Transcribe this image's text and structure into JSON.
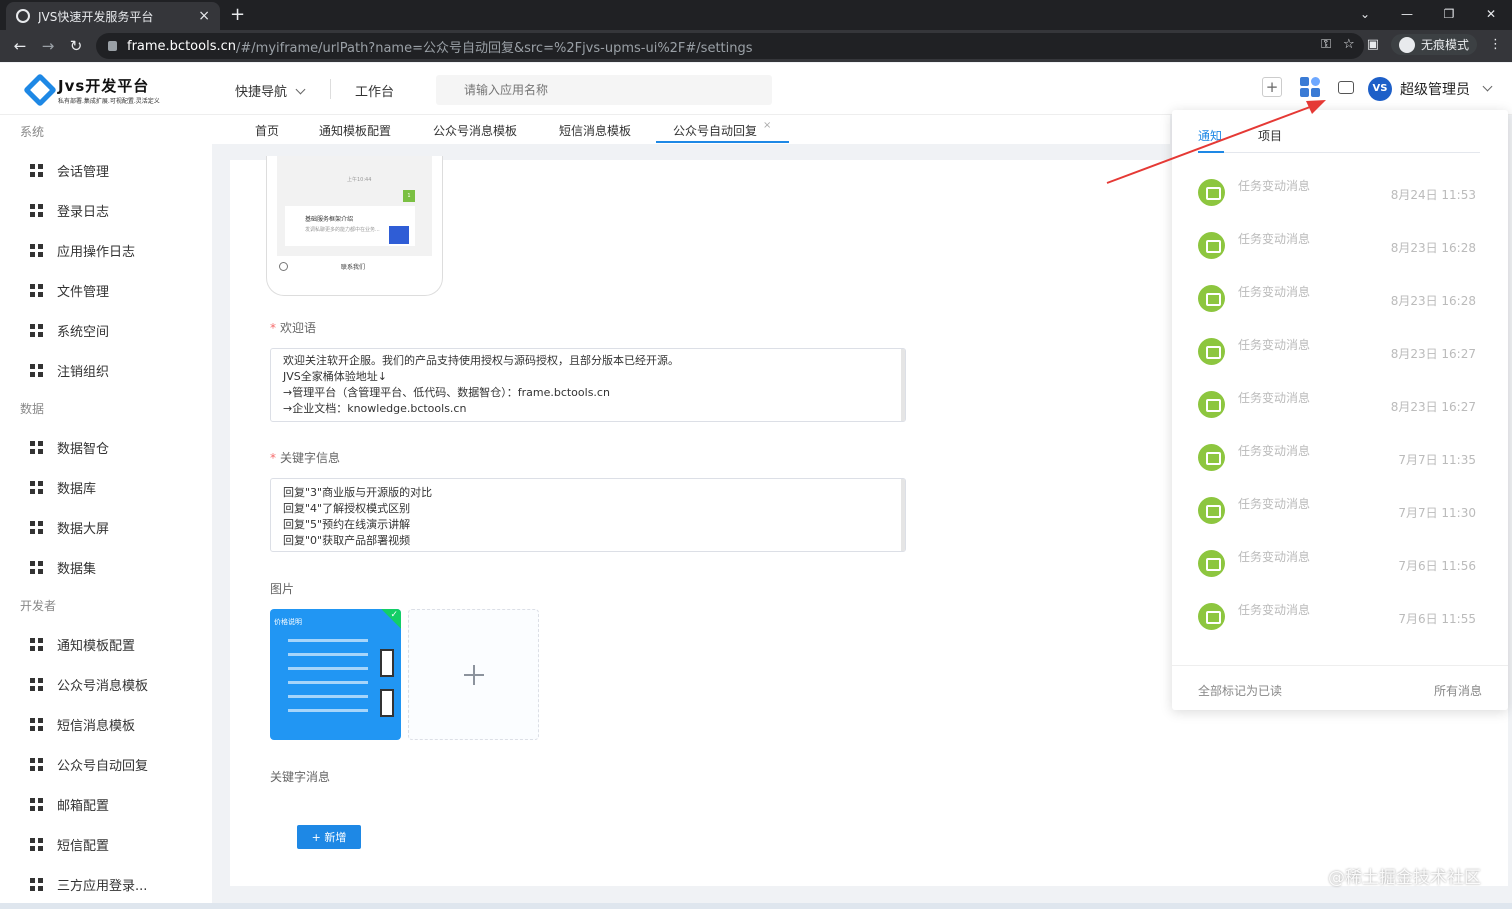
{
  "browser": {
    "tab_title": "JVS快速开发服务平台",
    "url_host": "frame.bctools.cn",
    "url_path": "/#/myiframe/urlPath?name=公众号自动回复&src=%2Fjvs-upms-ui%2F#/settings",
    "incognito_label": "无痕模式"
  },
  "header": {
    "logo_name": "Jvs开发平台",
    "logo_slogan": "私有部署.集成扩展.可视配置.灵活定义",
    "quick_nav": "快捷导航",
    "workbench": "工作台",
    "search_placeholder": "请输入应用名称",
    "user_avatar": "VS",
    "user_name": "超级管理员"
  },
  "sidebar": {
    "groups": [
      {
        "label": "系统",
        "items": [
          "会话管理",
          "登录日志",
          "应用操作日志",
          "文件管理",
          "系统空间",
          "注销组织"
        ]
      },
      {
        "label": "数据",
        "items": [
          "数据智仓",
          "数据库",
          "数据大屏",
          "数据集"
        ]
      },
      {
        "label": "开发者",
        "items": [
          "通知模板配置",
          "公众号消息模板",
          "短信消息模板",
          "公众号自动回复",
          "邮箱配置",
          "短信配置",
          "三方应用登录..."
        ]
      }
    ]
  },
  "page_tabs": [
    "首页",
    "通知模板配置",
    "公众号消息模板",
    "短信消息模板",
    "公众号自动回复"
  ],
  "page_tab_close": "×",
  "phone": {
    "time": "上午10:44",
    "badge": "1",
    "card_title": "基础服务框架介绍",
    "card_sub": "发调私聊更多的能力都中在业务...",
    "contact": "联系我们"
  },
  "form": {
    "welcome_label": "欢迎语",
    "welcome_lines": [
      "欢迎关注软开企服。我们的产品支持使用授权与源码授权，且部分版本已经开源。",
      "JVS全家桶体验地址↓",
      "→管理平台（含管理平台、低代码、数据智仓）：frame.bctools.cn",
      "→企业文档：knowledge.bctools.cn"
    ],
    "keyword_label": "关键字信息",
    "keyword_lines": [
      "回复\"3\"商业版与开源版的对比",
      "回复\"4\"了解授权模式区别",
      "回复\"5\"预约在线演示讲解",
      "回复\"0\"获取产品部署视频"
    ],
    "image_label": "图片",
    "image_thumb_title": "价格说明",
    "keyword_msg_label": "关键字消息",
    "add_button": "+ 新增"
  },
  "notifications": {
    "tabs": [
      "通知",
      "项目"
    ],
    "items": [
      {
        "title": "任务变动消息",
        "time": "8月24日 11:53"
      },
      {
        "title": "任务变动消息",
        "time": "8月23日 16:28"
      },
      {
        "title": "任务变动消息",
        "time": "8月23日 16:28"
      },
      {
        "title": "任务变动消息",
        "time": "8月23日 16:27"
      },
      {
        "title": "任务变动消息",
        "time": "8月23日 16:27"
      },
      {
        "title": "任务变动消息",
        "time": "7月7日 11:35"
      },
      {
        "title": "任务变动消息",
        "time": "7月7日 11:30"
      },
      {
        "title": "任务变动消息",
        "time": "7月6日 11:56"
      },
      {
        "title": "任务变动消息",
        "time": "7月6日 11:55"
      }
    ],
    "mark_all_read": "全部标记为已读",
    "all_messages": "所有消息"
  },
  "watermark": "@稀土掘金技术社区",
  "colors": {
    "accent": "#1e88e5",
    "notice_icon": "#8dc63f",
    "annotation_arrow": "#e53935"
  }
}
